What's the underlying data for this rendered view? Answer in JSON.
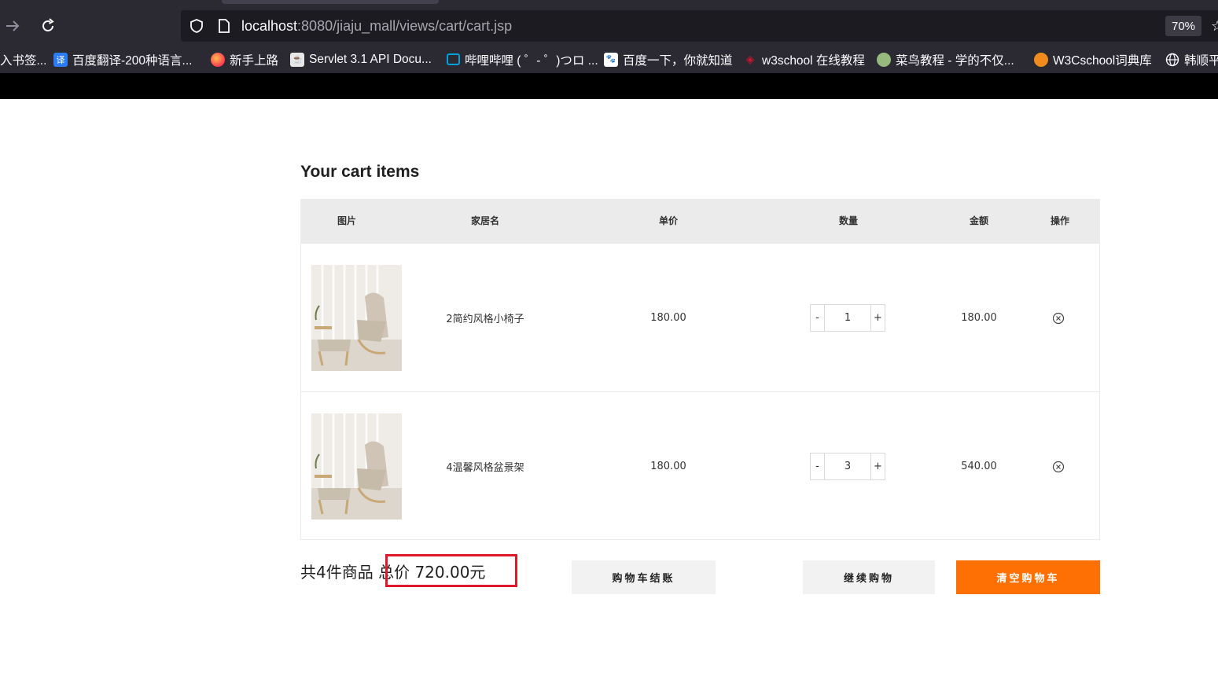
{
  "browser": {
    "url_host": "localhost",
    "url_path": ":8080/jiaju_mall/views/cart/cart.jsp",
    "zoom": "70%",
    "bookmarks": [
      {
        "label": "入书签...",
        "icon": "none"
      },
      {
        "label": "百度翻译-200种语言...",
        "icon": "translate-icon",
        "glyph": "译",
        "color": "#2b7cf6"
      },
      {
        "label": "新手上路",
        "icon": "firefox-icon",
        "glyph": "",
        "color": "#ff7139"
      },
      {
        "label": "Servlet 3.1 API Docu...",
        "icon": "java-doc-icon",
        "glyph": "",
        "color": "#e8e8e8"
      },
      {
        "label": "哔哩哔哩 ( ゜- ゜)つロ ...",
        "icon": "bilibili-icon",
        "glyph": "",
        "color": "#00a1d6"
      },
      {
        "label": "百度一下，你就知道",
        "icon": "baidu-icon",
        "glyph": "du",
        "color": "#2932e1"
      },
      {
        "label": "w3school 在线教程",
        "icon": "w3school-icon",
        "glyph": "",
        "color": "#c7162b"
      },
      {
        "label": "菜鸟教程 - 学的不仅...",
        "icon": "runoob-icon",
        "glyph": "",
        "color": "#96b97d"
      },
      {
        "label": "W3Cschool词典库",
        "icon": "w3cschool-icon",
        "glyph": "",
        "color": "#f08c1d"
      },
      {
        "label": "韩顺平",
        "icon": "globe-icon",
        "glyph": "",
        "color": "#2b2a33"
      }
    ]
  },
  "page": {
    "title": "Your cart items"
  },
  "table": {
    "headers": [
      "图片",
      "家居名",
      "单价",
      "数量",
      "金额",
      "操作"
    ],
    "rows": [
      {
        "name": "2简约风格小椅子",
        "unit_price": "180.00",
        "quantity": "1",
        "amount": "180.00"
      },
      {
        "name": "4温馨风格盆景架",
        "unit_price": "180.00",
        "quantity": "3",
        "amount": "540.00"
      }
    ],
    "minus_label": "-",
    "plus_label": "+"
  },
  "summary": {
    "count_text": "共4件商品",
    "total_label": "总价",
    "total_value": "720.00元",
    "highlight_color": "#e0182b"
  },
  "actions": {
    "checkout": "购物车结账",
    "continue": "继续购物",
    "clear": "清空购物车",
    "clear_color": "#ff7004"
  }
}
